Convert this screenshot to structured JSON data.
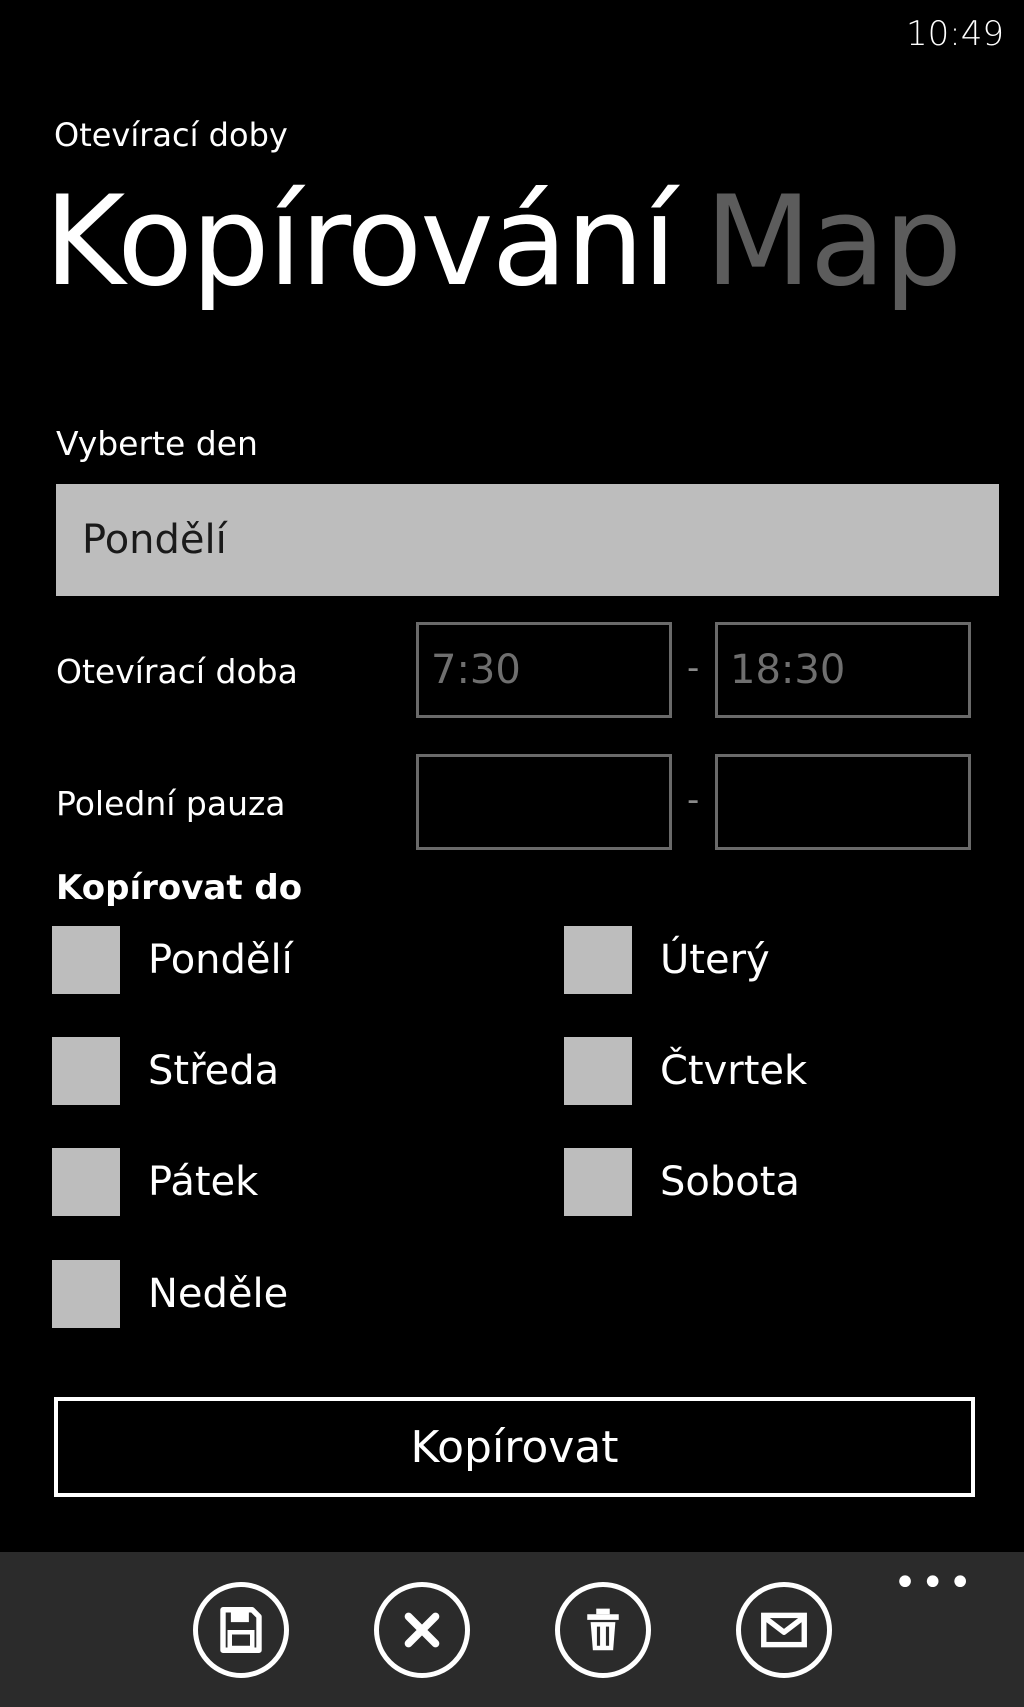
{
  "status": {
    "time": "10:49"
  },
  "app": {
    "title": "Otevírací doby"
  },
  "pivot": {
    "active": "Kopírování",
    "next": "Map"
  },
  "day_select": {
    "label": "Vyberte den",
    "value": "Pondělí"
  },
  "opening_hours": {
    "label": "Otevírací doba",
    "from": "7:30",
    "dash": "-",
    "to": "18:30"
  },
  "lunch_break": {
    "label": "Polední pauza",
    "from": "",
    "dash": "-",
    "to": ""
  },
  "copy_to": {
    "label": "Kopírovat do",
    "days": [
      "Pondělí",
      "Úterý",
      "Středa",
      "Čtvrtek",
      "Pátek",
      "Sobota",
      "Neděle"
    ]
  },
  "copy_button": {
    "label": "Kopírovat"
  },
  "app_bar": {
    "more": "•••",
    "icons": [
      "save-icon",
      "close-icon",
      "delete-icon",
      "email-icon"
    ]
  }
}
